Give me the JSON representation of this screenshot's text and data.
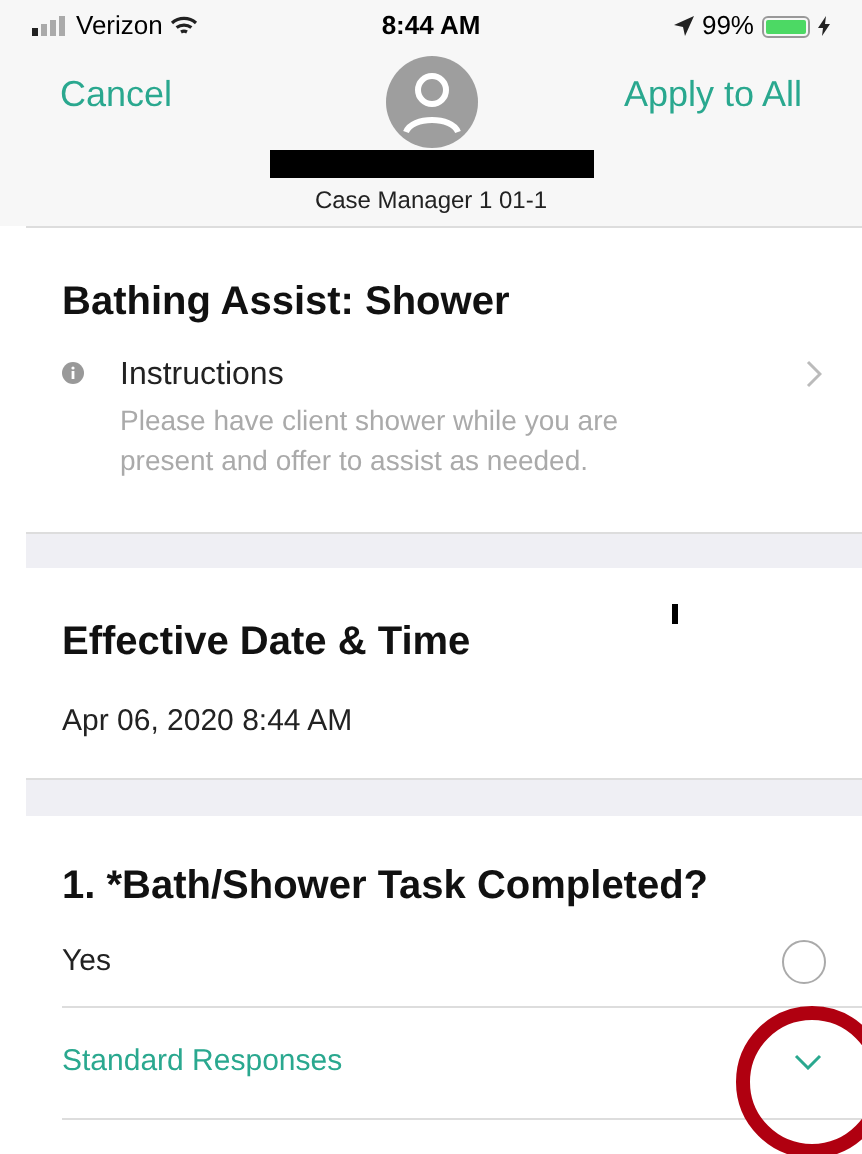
{
  "status_bar": {
    "carrier": "Verizon",
    "time": "8:44 AM",
    "battery": "99%"
  },
  "nav": {
    "left": "Cancel",
    "right": "Apply to All",
    "subtitle": "Case Manager 1 01-1"
  },
  "task": {
    "title": "Bathing Assist: Shower",
    "instructions_label": "Instructions",
    "instructions_text": "Please have client shower while you are present and offer to assist as needed."
  },
  "effective": {
    "title": "Effective Date & Time",
    "value": "Apr 06, 2020 8:44 AM"
  },
  "question": {
    "title": "1. *Bath/Shower Task Completed?",
    "options": [
      {
        "label": "Yes",
        "selected": false
      }
    ],
    "standard_responses": {
      "label": "Standard Responses",
      "expanded": false
    }
  }
}
